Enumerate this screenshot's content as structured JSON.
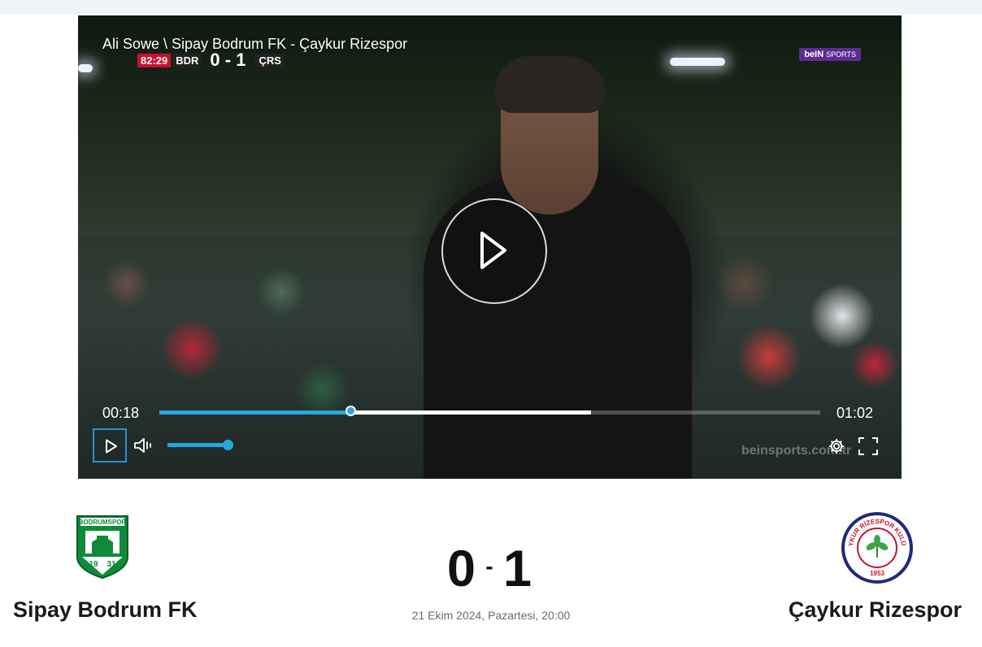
{
  "video": {
    "title": "Ali Sowe \\ Sipay Bodrum FK - Çaykur Rizespor",
    "scorebug": {
      "clock": "82:29",
      "home_abbr": "BDR",
      "score": "0 - 1",
      "away_abbr": "ÇRS"
    },
    "channel_logo": {
      "brand": "beIN",
      "suffix": "SPORTS"
    },
    "watermark": "beinsports.com.tr",
    "current_time": "00:18",
    "duration": "01:02",
    "played_fraction": 0.29,
    "buffered_fraction": 0.653,
    "volume_fraction": 1.0,
    "accent_color": "#23a8dd"
  },
  "match": {
    "home": {
      "name": "Sipay Bodrum FK",
      "crest_text": "BODRUMSPOR",
      "crest_year_left": "19",
      "crest_year_right": "31"
    },
    "away": {
      "name": "Çaykur Rizespor",
      "crest_text": "ÇAYKUR RİZESPOR KULÜBÜ",
      "crest_year": "1953"
    },
    "home_score": "0",
    "separator": "-",
    "away_score": "1",
    "date": "21 Ekim 2024, Pazartesi, 20:00"
  },
  "icons": [
    "play-icon",
    "volume-icon",
    "gear-icon",
    "fullscreen-icon"
  ]
}
